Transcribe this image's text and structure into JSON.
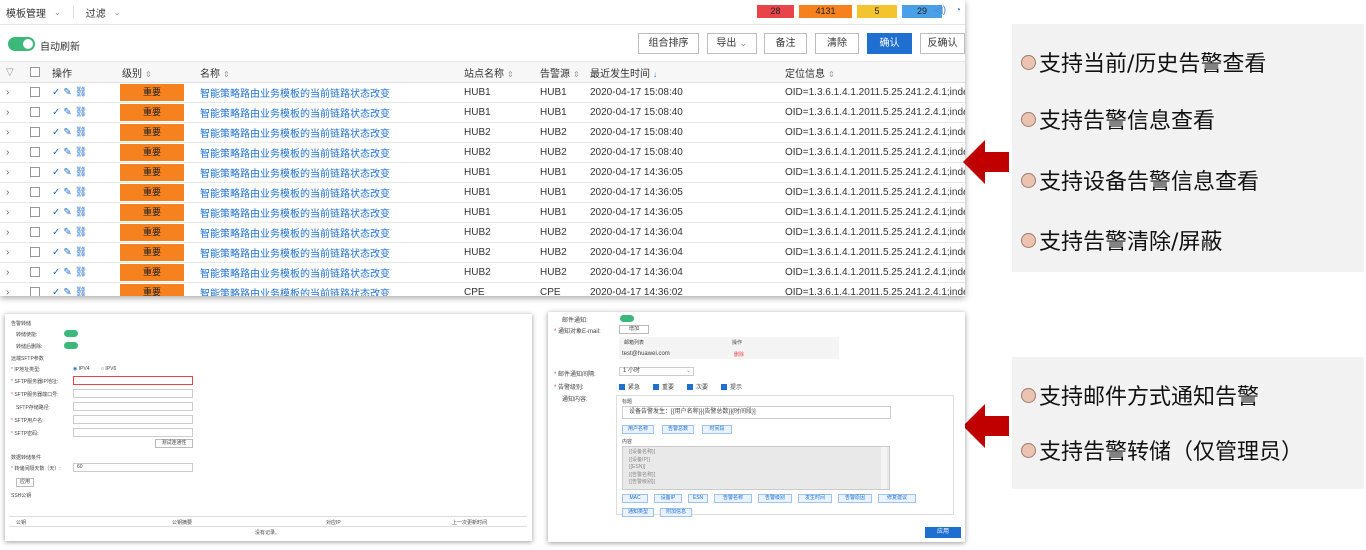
{
  "topbar": {
    "breadcrumb": "模板管理",
    "filter": "过滤",
    "counts": {
      "critical": "28",
      "major": "4131",
      "minor": "5",
      "warning": "29"
    }
  },
  "toolbar": {
    "auto_refresh": "自动刷新",
    "combo_sort": "组合排序",
    "export": "导出",
    "note": "备注",
    "clear": "清除",
    "confirm": "确认",
    "unconfirm": "反确认"
  },
  "table": {
    "headers": {
      "ops": "操作",
      "level": "级别",
      "name": "名称",
      "site": "站点名称",
      "source": "告警源",
      "time": "最近发生时间",
      "location": "定位信息"
    },
    "rows": [
      {
        "level": "重要",
        "name": "智能策略路由业务模板的当前链路状态改变",
        "site": "HUB1",
        "source": "HUB1",
        "time": "2020-04-17 15:08:40",
        "location": "OID=1.3.6.1.4.1.2011.5.25.241.2.4.1;index=15"
      },
      {
        "level": "重要",
        "name": "智能策略路由业务模板的当前链路状态改变",
        "site": "HUB1",
        "source": "HUB1",
        "time": "2020-04-17 15:08:40",
        "location": "OID=1.3.6.1.4.1.2011.5.25.241.2.4.1;index=15"
      },
      {
        "level": "重要",
        "name": "智能策略路由业务模板的当前链路状态改变",
        "site": "HUB2",
        "source": "HUB2",
        "time": "2020-04-17 15:08:40",
        "location": "OID=1.3.6.1.4.1.2011.5.25.241.2.4.1;index=15"
      },
      {
        "level": "重要",
        "name": "智能策略路由业务模板的当前链路状态改变",
        "site": "HUB2",
        "source": "HUB2",
        "time": "2020-04-17 15:08:40",
        "location": "OID=1.3.6.1.4.1.2011.5.25.241.2.4.1;index=15"
      },
      {
        "level": "重要",
        "name": "智能策略路由业务模板的当前链路状态改变",
        "site": "HUB1",
        "source": "HUB1",
        "time": "2020-04-17 14:36:05",
        "location": "OID=1.3.6.1.4.1.2011.5.25.241.2.4.1;index=15"
      },
      {
        "level": "重要",
        "name": "智能策略路由业务模板的当前链路状态改变",
        "site": "HUB1",
        "source": "HUB1",
        "time": "2020-04-17 14:36:05",
        "location": "OID=1.3.6.1.4.1.2011.5.25.241.2.4.1;index=15"
      },
      {
        "level": "重要",
        "name": "智能策略路由业务模板的当前链路状态改变",
        "site": "HUB1",
        "source": "HUB1",
        "time": "2020-04-17 14:36:05",
        "location": "OID=1.3.6.1.4.1.2011.5.25.241.2.4.1;index=15"
      },
      {
        "level": "重要",
        "name": "智能策略路由业务模板的当前链路状态改变",
        "site": "HUB2",
        "source": "HUB2",
        "time": "2020-04-17 14:36:04",
        "location": "OID=1.3.6.1.4.1.2011.5.25.241.2.4.1;index=15"
      },
      {
        "level": "重要",
        "name": "智能策略路由业务模板的当前链路状态改变",
        "site": "HUB2",
        "source": "HUB2",
        "time": "2020-04-17 14:36:04",
        "location": "OID=1.3.6.1.4.1.2011.5.25.241.2.4.1;index=15"
      },
      {
        "level": "重要",
        "name": "智能策略路由业务模板的当前链路状态改变",
        "site": "HUB2",
        "source": "HUB2",
        "time": "2020-04-17 14:36:04",
        "location": "OID=1.3.6.1.4.1.2011.5.25.241.2.4.1;index=15"
      },
      {
        "level": "重要",
        "name": "智能策略路由业务模板的当前链路状态改变",
        "site": "CPE",
        "source": "CPE",
        "time": "2020-04-17 14:36:02",
        "location": "OID=1.3.6.1.4.1.2011.5.25.241.2.4.1;index=15"
      }
    ]
  },
  "features_top": [
    "支持当前/历史告警查看",
    "支持告警信息查看",
    "支持设备告警信息查看",
    "支持告警清除/屏蔽"
  ],
  "features_bottom": [
    "支持邮件方式通知告警",
    "支持告警转储（仅管理员）"
  ],
  "storage": {
    "title": "告警转储",
    "dump_enable": "转储使能:",
    "dump_before_delete": "转储后删除:",
    "sftp_params": "远端SFTP参数",
    "ip_type": "IP地址类型:",
    "ipv4": "IPV4",
    "ipv6": "IPV6",
    "sftp_ip": "SFTP服务器IP地址:",
    "sftp_port": "SFTP服务器端口号:",
    "sftp_path": "SFTP存储路径:",
    "sftp_user": "SFTP用户名:",
    "sftp_pass": "SFTP密码:",
    "test_conn": "测试连通性",
    "conditions": "数据转储条件",
    "days_label": "转储间隔天数（天）:",
    "days_value": "60",
    "apply": "应用",
    "ssh_key": "SSH公钥",
    "col_key": "公钥",
    "col_fingerprint": "公钥摘要",
    "col_ip": "对应IP",
    "col_time": "上一次更新时间",
    "empty": "没有记录。"
  },
  "email": {
    "notify": "邮件通知:",
    "recipient": "通知对象E-mail:",
    "add": "增加",
    "col_email": "邮箱列表",
    "col_op": "操作",
    "email_value": "test@huawei.com",
    "delete": "删除",
    "interval": "邮件通知间隔:",
    "interval_value": "1 小时",
    "level": "告警级别:",
    "levels": [
      "紧急",
      "重要",
      "次要",
      "提示"
    ],
    "content": "通知内容:",
    "subject_label": "标题",
    "subject_value": "设备告警发生：[{用户名称}]{告警总数}]{时间段}]",
    "chips_subject": [
      "用户名称",
      "告警总数",
      "时间段"
    ],
    "body_label": "内容",
    "body_lines": [
      "[{设备名称}]",
      "[{设备IP}]",
      "[{ESN}]",
      "[{告警名称}]",
      "[{告警级别}]"
    ],
    "chips_body": [
      "MAC",
      "设备IP",
      "ESN",
      "告警名称",
      "告警级别",
      "发生时间",
      "告警原因",
      "修复建议",
      "通知类型",
      "附加信息"
    ],
    "apply": "应用"
  }
}
